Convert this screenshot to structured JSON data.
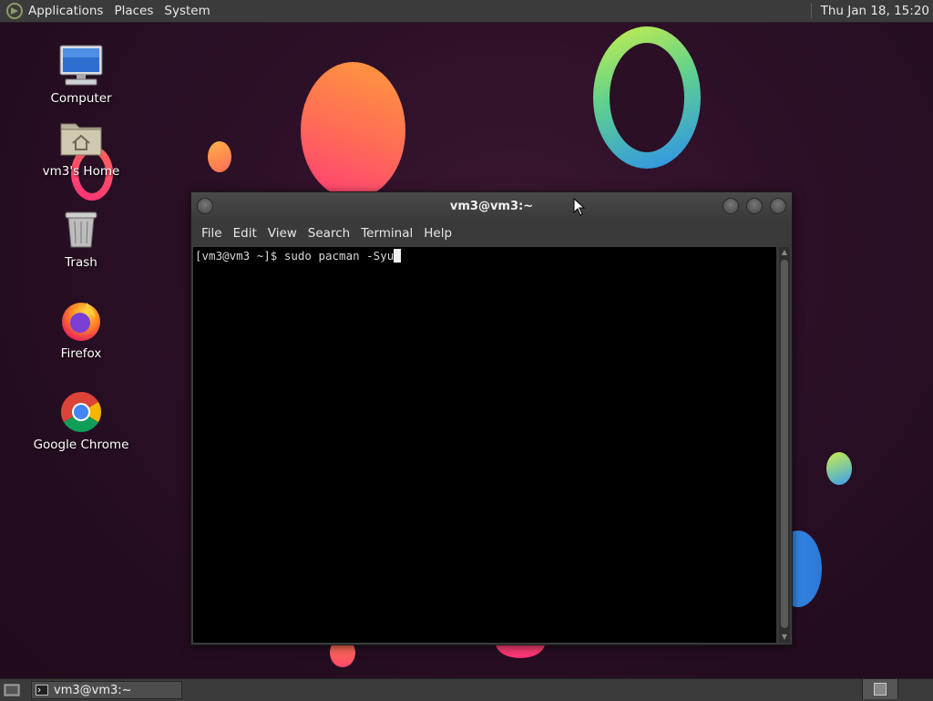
{
  "top_panel": {
    "menus": [
      "Applications",
      "Places",
      "System"
    ],
    "clock": "Thu Jan 18, 15:20"
  },
  "desktop": {
    "icons": [
      {
        "label": "Computer",
        "icon": "computer-icon"
      },
      {
        "label": "vm3's Home",
        "icon": "home-folder-icon"
      },
      {
        "label": "Trash",
        "icon": "trash-icon"
      },
      {
        "label": "Firefox",
        "icon": "firefox-icon"
      },
      {
        "label": "Google Chrome",
        "icon": "chrome-icon"
      }
    ]
  },
  "terminal": {
    "title": "vm3@vm3:~",
    "menus": [
      "File",
      "Edit",
      "View",
      "Search",
      "Terminal",
      "Help"
    ],
    "prompt": "[vm3@vm3 ~]$ ",
    "command": "sudo pacman -Syu"
  },
  "bottom_panel": {
    "task_label": "vm3@vm3:~"
  },
  "colors": {
    "panel": "#3b3b3b",
    "terminal_bg": "#000000",
    "wallpaper": "#2a0f25"
  }
}
